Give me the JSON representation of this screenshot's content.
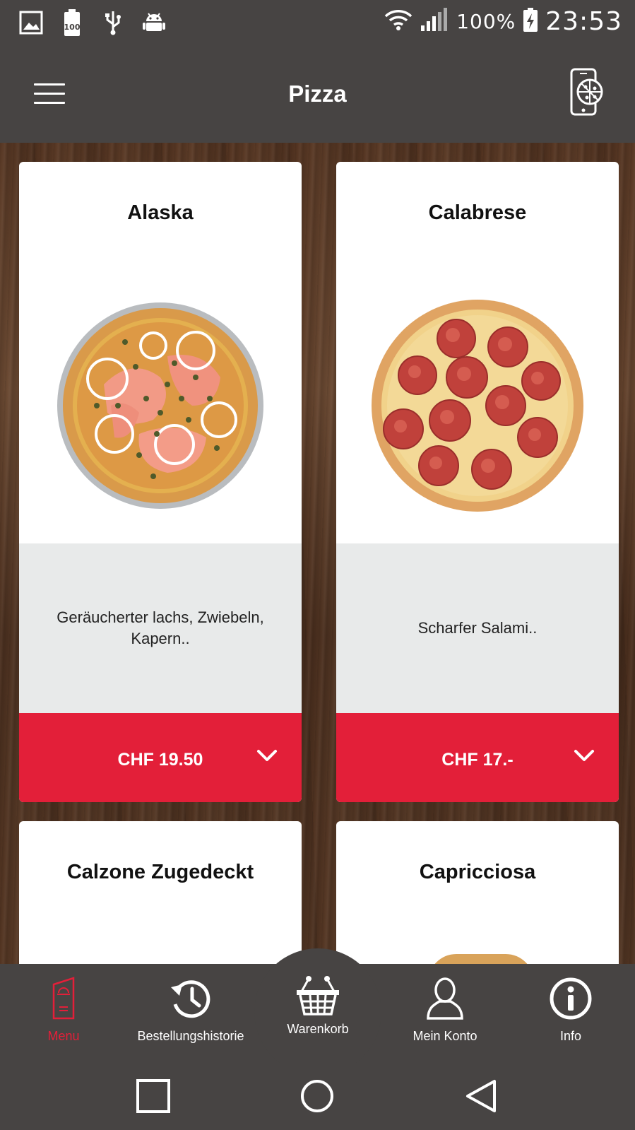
{
  "status_bar": {
    "battery_percent": "100%",
    "time": "23:53",
    "icons": [
      "image-icon",
      "battery-100-icon",
      "usb-icon",
      "android-icon",
      "wifi-icon",
      "signal-icon",
      "battery-charging-icon"
    ]
  },
  "app_bar": {
    "title": "Pizza",
    "left_icon": "hamburger-menu-icon",
    "right_icon": "phone-pizza-icon"
  },
  "cards": [
    {
      "title": "Alaska",
      "description": "Geräucherter lachs, Zwiebeln, Kapern..",
      "price": "CHF 19.50"
    },
    {
      "title": "Calabrese",
      "description": "Scharfer Salami..",
      "price": "CHF 17.-"
    },
    {
      "title": "Calzone Zugedeckt"
    },
    {
      "title": "Capricciosa"
    }
  ],
  "bottom_nav": {
    "menu": "Menu",
    "history": "Bestellungshistorie",
    "cart": "Warenkorb",
    "account": "Mein Konto",
    "info": "Info"
  },
  "colors": {
    "accent": "#e31f39",
    "bar": "#474443",
    "description_bg": "#e8eaea"
  }
}
